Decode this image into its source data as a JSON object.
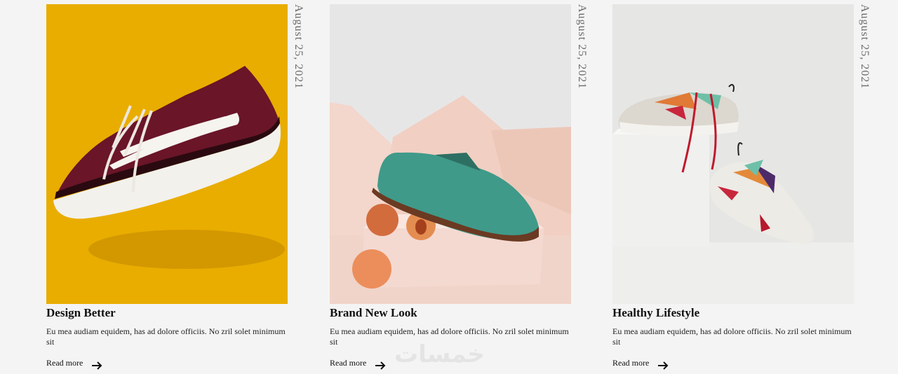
{
  "posts": [
    {
      "title": "Design Better",
      "date": "August 25, 2021",
      "excerpt": "Eu mea audiam equidem, has ad dolore officiis. No zril solet minimum sit",
      "read_more": "Read more",
      "image": "burgundy-sneaker-on-yellow",
      "accent": "#e8ac00"
    },
    {
      "title": "Brand New Look",
      "date": "August 25, 2021",
      "excerpt": "Eu mea audiam equidem, has ad dolore officiis. No zril solet minimum sit",
      "read_more": "Read more",
      "image": "teal-shoe-with-peaches",
      "accent": "#3e9b88"
    },
    {
      "title": "Healthy Lifestyle",
      "date": "August 25, 2021",
      "excerpt": "Eu mea audiam equidem, has ad dolore officiis. No zril solet minimum sit",
      "read_more": "Read more",
      "image": "colorful-sneakers-on-white-blocks",
      "accent": "#e8e8e6"
    }
  ],
  "watermark": "خمسات",
  "icons": {
    "read_more": "arrow-right-icon"
  }
}
